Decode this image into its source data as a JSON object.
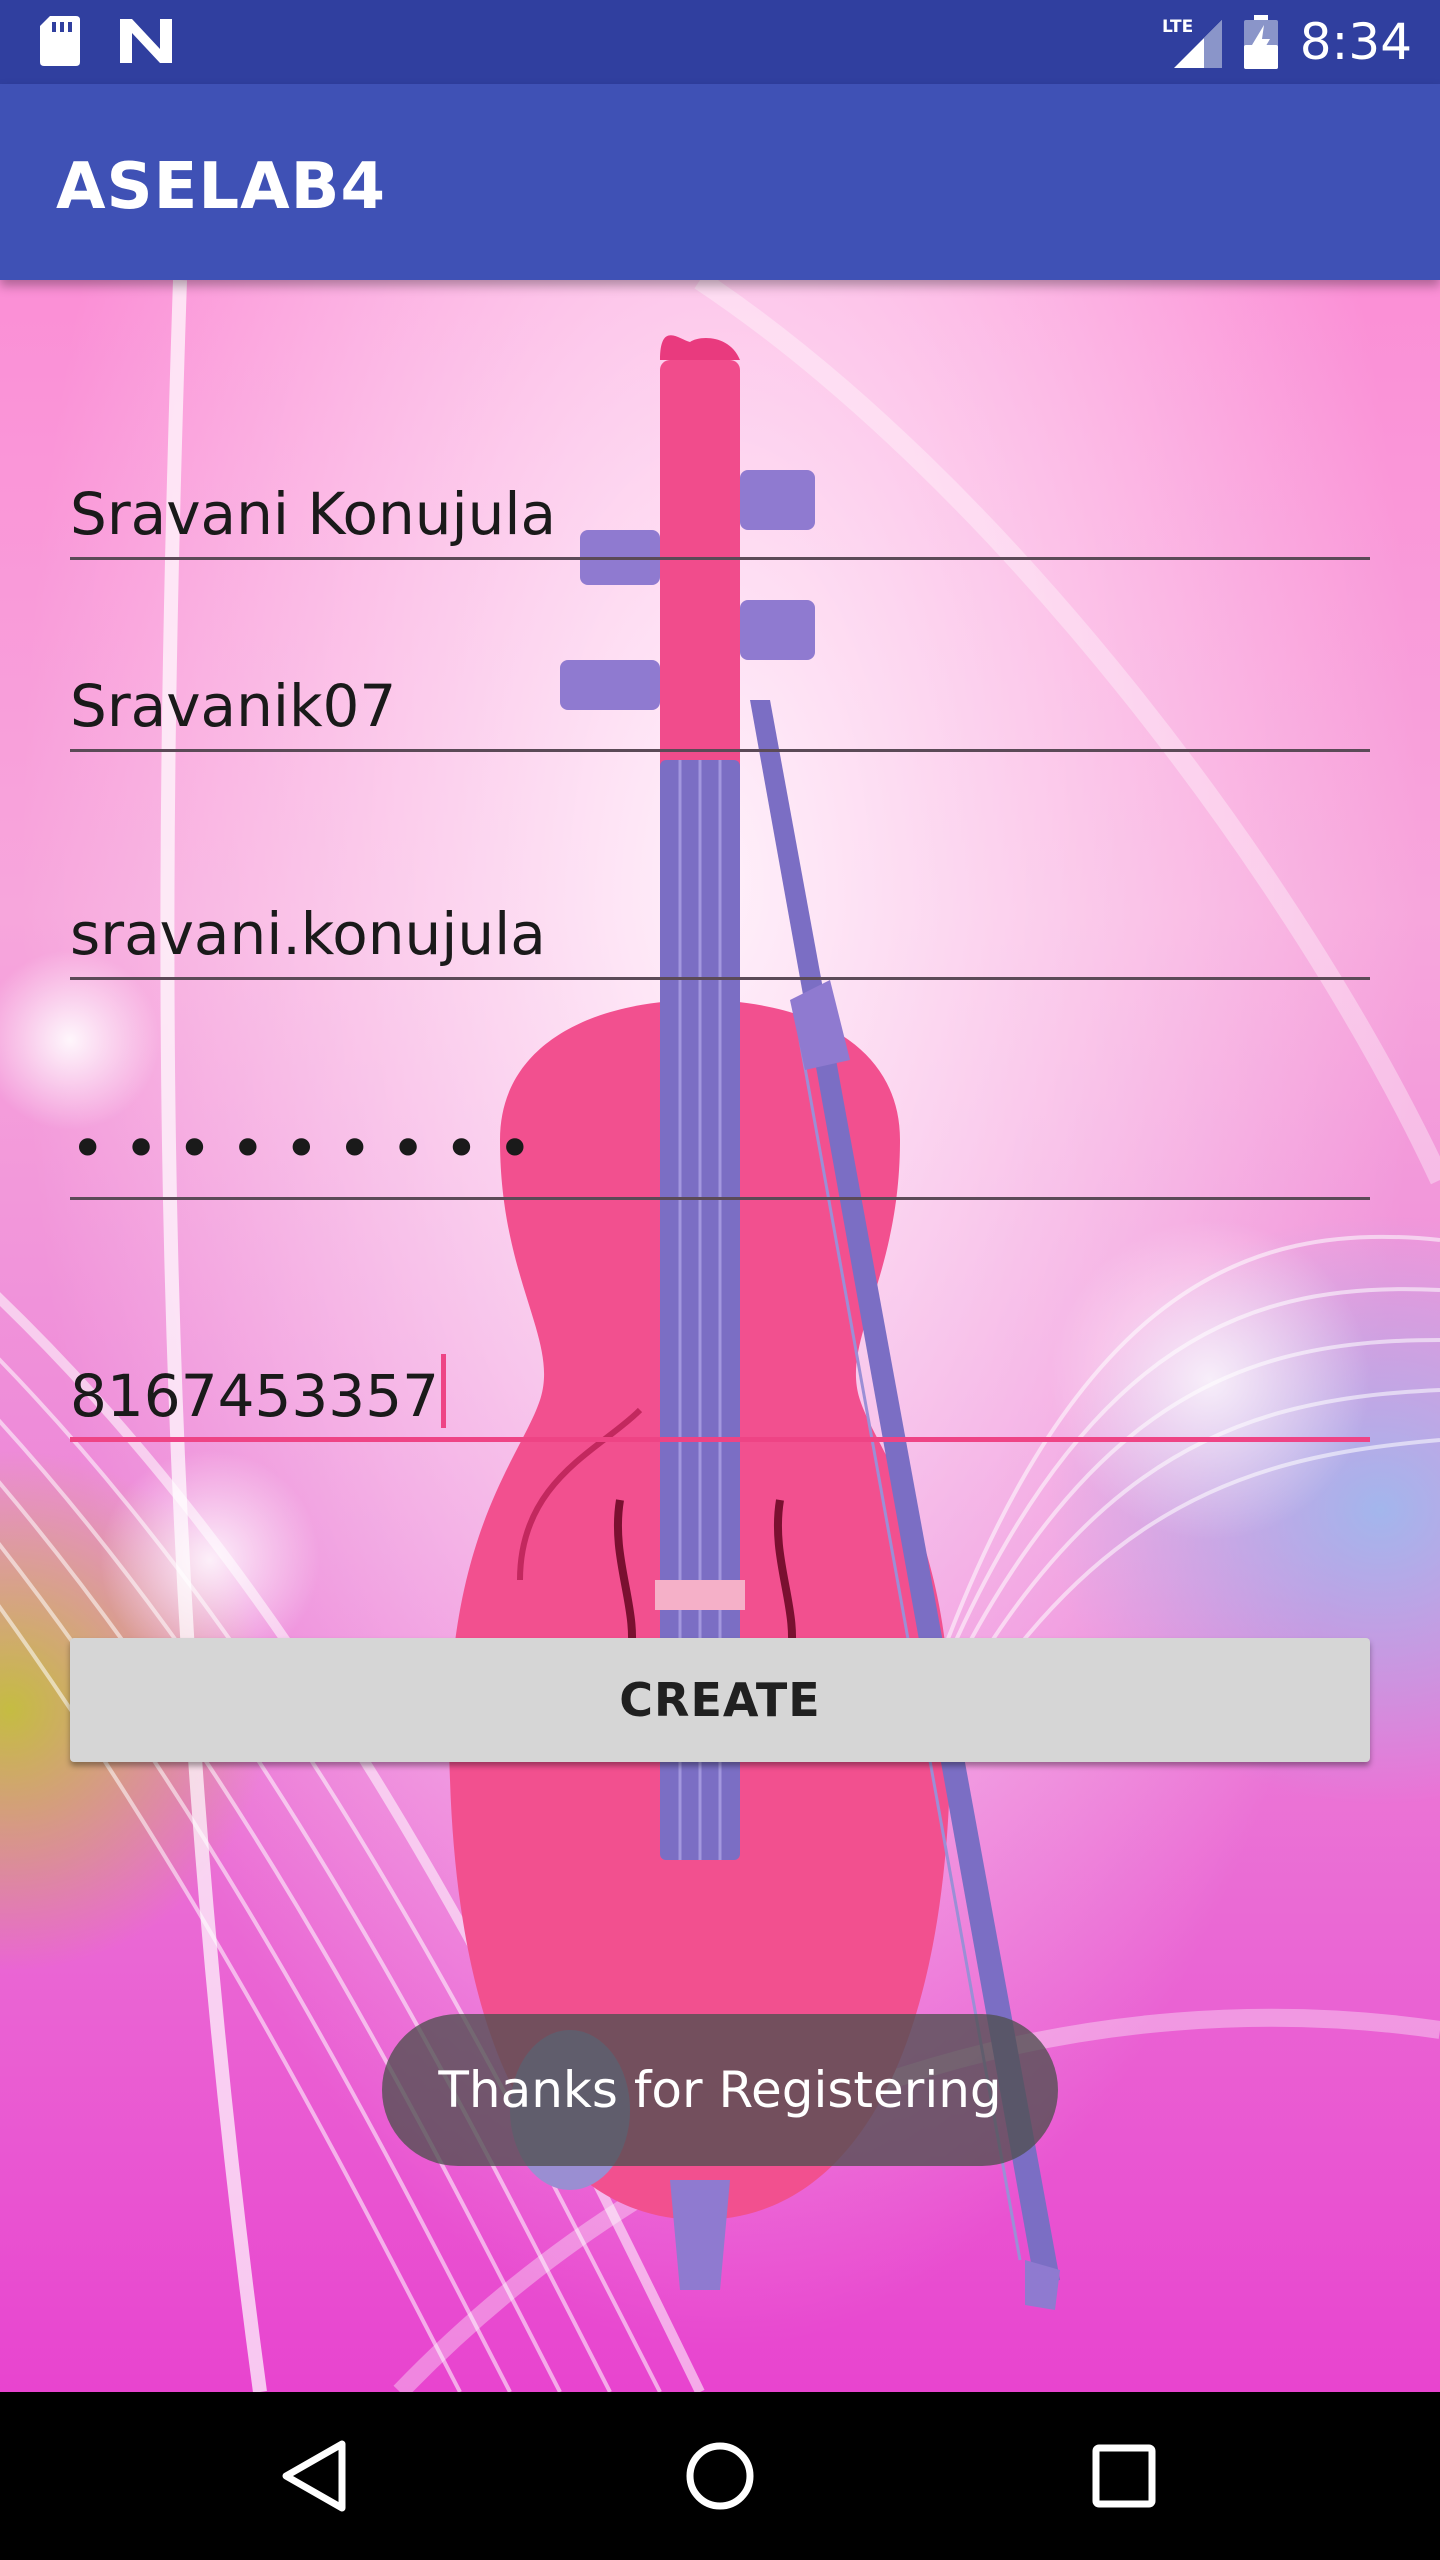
{
  "status_bar": {
    "time": "8:34",
    "icons": [
      "sd-card-icon",
      "n-notification-icon",
      "lte-signal-icon",
      "battery-icon"
    ]
  },
  "app_bar": {
    "title": "ASELAB4"
  },
  "form": {
    "name": "Sravani Konujula",
    "username": "Sravanik07",
    "email": "sravani.konujula",
    "password_mask": "•••••••••",
    "phone": "8167453357"
  },
  "create_button": {
    "label": "CREATE"
  },
  "toast": {
    "message": "Thanks for Registering"
  },
  "nav_bar": {
    "icons": [
      "back-icon",
      "home-icon",
      "recents-icon"
    ]
  },
  "colors": {
    "status_bar": "#303f9f",
    "app_bar": "#3f51b5",
    "accent": "#ee4485",
    "button": "#d6d6d6"
  }
}
